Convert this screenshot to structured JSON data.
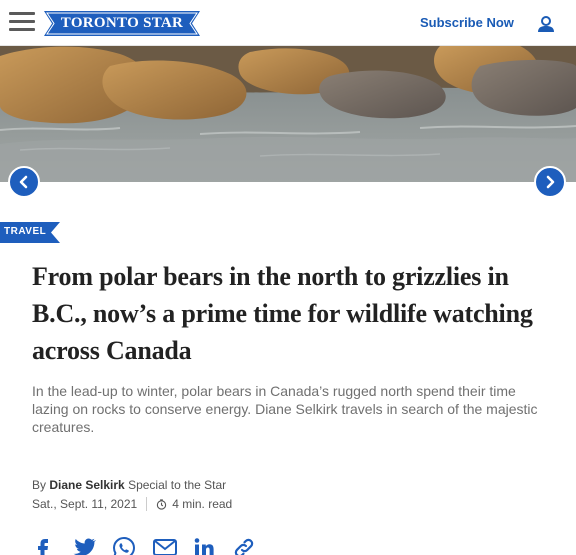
{
  "header": {
    "logo_text": "TORONTO STAR",
    "subscribe_label": "Subscribe Now",
    "brand_color": "#1a5bb5"
  },
  "hero": {
    "prev_icon": "chevron-left-icon",
    "next_icon": "chevron-right-icon"
  },
  "article": {
    "category": "TRAVEL",
    "headline": "From polar bears in the north to grizzlies in B.C., now’s a prime time for wildlife watching across Canada",
    "dek": "In the lead-up to winter, polar bears in Canada’s rugged north spend their time lazing on rocks to conserve energy. Diane Selkirk travels in search of the majestic creatures.",
    "byline_prefix": "By",
    "author": "Diane Selkirk",
    "author_role": "Special to the Star",
    "date": "Sat., Sept. 11, 2021",
    "read_time": "4 min. read"
  },
  "share_icons": [
    "facebook-icon",
    "twitter-icon",
    "whatsapp-icon",
    "email-icon",
    "linkedin-icon",
    "link-icon"
  ]
}
